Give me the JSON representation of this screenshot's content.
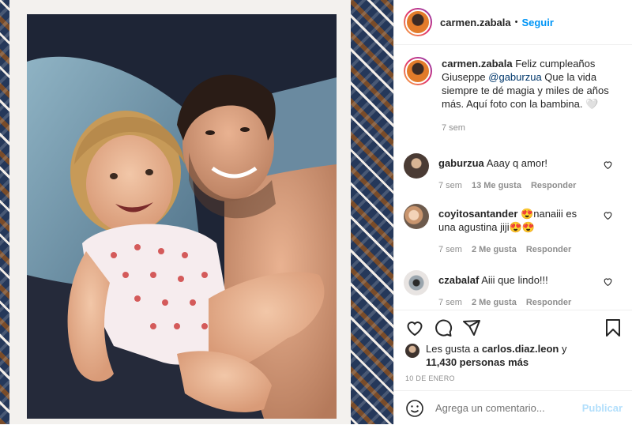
{
  "post": {
    "username": "carmen.zabala",
    "follow_label": "Seguir",
    "separator": "•",
    "caption": {
      "username": "carmen.zabala",
      "text_before": "Feliz cumpleaños Giuseppe ",
      "mention": "@gaburzua",
      "text_after": " Que la vida siempre te dé magia y miles de años más. Aquí foto con la bambina. 🤍",
      "time": "7 sem"
    },
    "comments": [
      {
        "username": "gaburzua",
        "text": "Aaay q amor!",
        "time": "7 sem",
        "likes": "13 Me gusta",
        "reply": "Responder"
      },
      {
        "username": "coyitosantander",
        "text": "😍nanaiii es una agustina jiji😍😍",
        "time": "7 sem",
        "likes": "2 Me gusta",
        "reply": "Responder"
      },
      {
        "username": "czabalaf",
        "text": "Aiii que lindo!!!",
        "time": "7 sem",
        "likes": "2 Me gusta",
        "reply": "Responder"
      }
    ],
    "likes": {
      "prefix": "Les gusta a ",
      "user": "carlos.diaz.leon",
      "middle": " y",
      "count": "11,430 personas más"
    },
    "date": "10 DE ENERO",
    "add_comment_placeholder": "Agrega un comentario...",
    "publish_label": "Publicar"
  },
  "colors": {
    "accent": "#0095f6",
    "publish_disabled": "#b2dffc",
    "meta": "#8e8e8e"
  },
  "icons": [
    "heart-icon",
    "comment-icon",
    "share-icon",
    "bookmark-icon",
    "emoji-icon",
    "small-heart-icon"
  ]
}
